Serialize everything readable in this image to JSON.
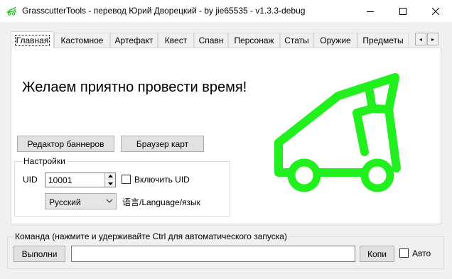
{
  "window": {
    "title": "GrasscutterTools - перевод Юрий Дворецкий  - by jie65535  - v1.3.3-debug",
    "icon": "grasscutter-app-icon",
    "controls": [
      "minimize-icon",
      "maximize-icon",
      "close-icon"
    ]
  },
  "tabs": [
    {
      "label": "Главная",
      "active": true
    },
    {
      "label": "Кастомное",
      "active": false
    },
    {
      "label": "Артефакт",
      "active": false
    },
    {
      "label": "Квест",
      "active": false
    },
    {
      "label": "Спавн",
      "active": false
    },
    {
      "label": "Персонаж",
      "active": false
    },
    {
      "label": "Статы",
      "active": false
    },
    {
      "label": "Оружие",
      "active": false
    },
    {
      "label": "Предметы",
      "active": false
    }
  ],
  "tab_scroll": {
    "left": "◂",
    "right": "▸"
  },
  "home": {
    "welcome": "Желаем приятно провести время!",
    "banner_editor_button": "Редактор баннеров",
    "map_browser_button": "Браузер карт",
    "logo_color": "#22f01e",
    "settings": {
      "group_label": "Настройки",
      "uid_label": "UID",
      "uid_value": "10001",
      "include_uid_label": "Включить UID",
      "include_uid_checked": false,
      "language_value": "Русский",
      "language_label": "语言/Language/язык"
    }
  },
  "command": {
    "group_label": "Команда (нажмите и удерживайте Ctrl для автоматического запуска)",
    "run_button": "Выполни",
    "input_value": "",
    "copy_button": "Копи",
    "auto_label": "Авто",
    "auto_checked": false
  }
}
